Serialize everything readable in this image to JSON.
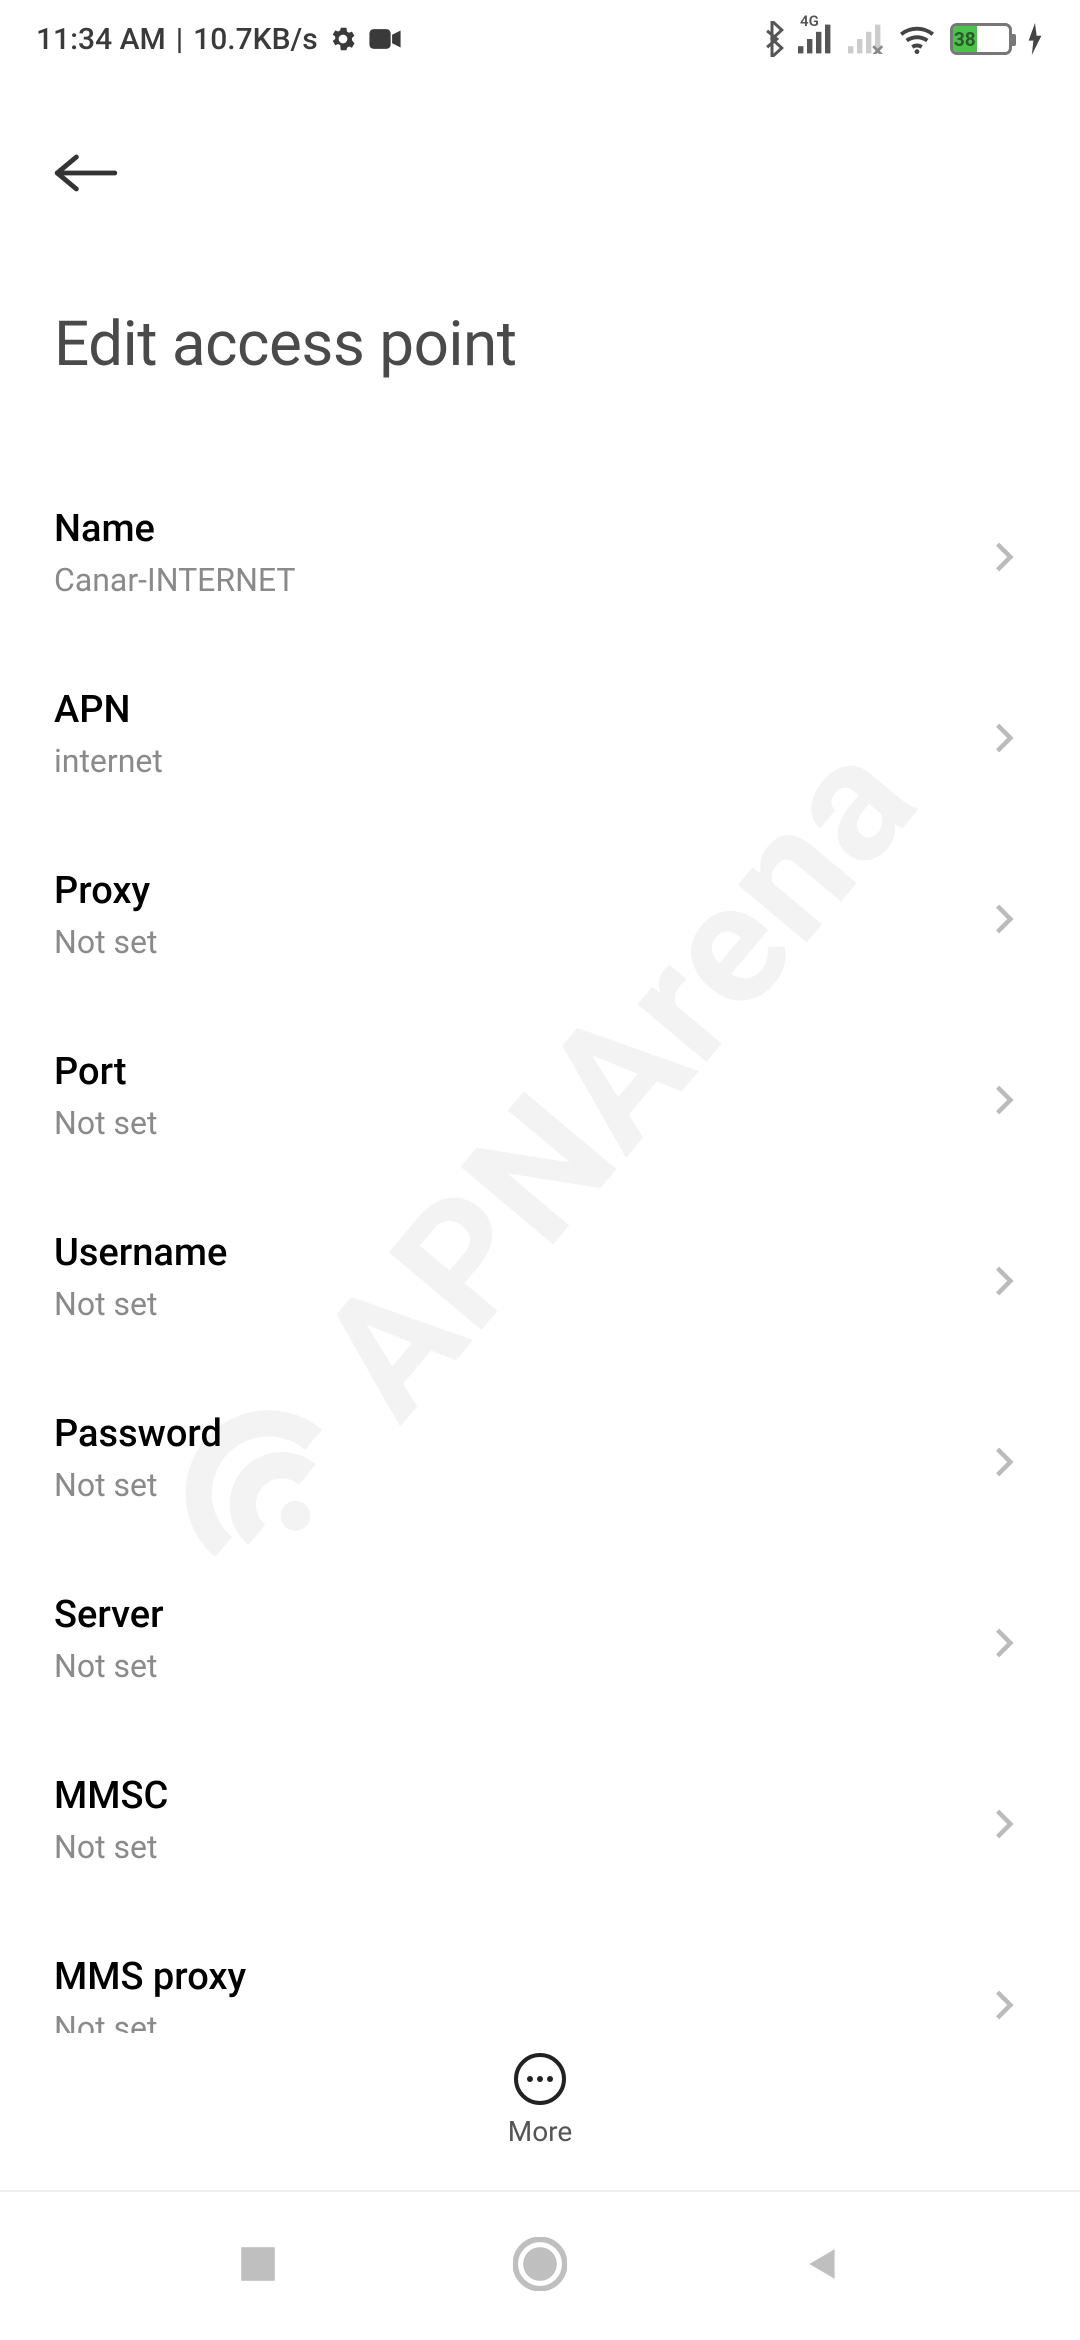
{
  "status": {
    "time": "11:34 AM",
    "separator": "|",
    "speed": "10.7KB/s",
    "network_label": "4G",
    "battery_level": "38"
  },
  "header": {
    "title": "Edit access point"
  },
  "items": [
    {
      "title": "Name",
      "sub": "Canar-INTERNET"
    },
    {
      "title": "APN",
      "sub": "internet"
    },
    {
      "title": "Proxy",
      "sub": "Not set"
    },
    {
      "title": "Port",
      "sub": "Not set"
    },
    {
      "title": "Username",
      "sub": "Not set"
    },
    {
      "title": "Password",
      "sub": "Not set"
    },
    {
      "title": "Server",
      "sub": "Not set"
    },
    {
      "title": "MMSC",
      "sub": "Not set"
    },
    {
      "title": "MMS proxy",
      "sub": "Not set"
    }
  ],
  "float": {
    "more_label": "More"
  },
  "watermark": {
    "text": "APNArena"
  }
}
